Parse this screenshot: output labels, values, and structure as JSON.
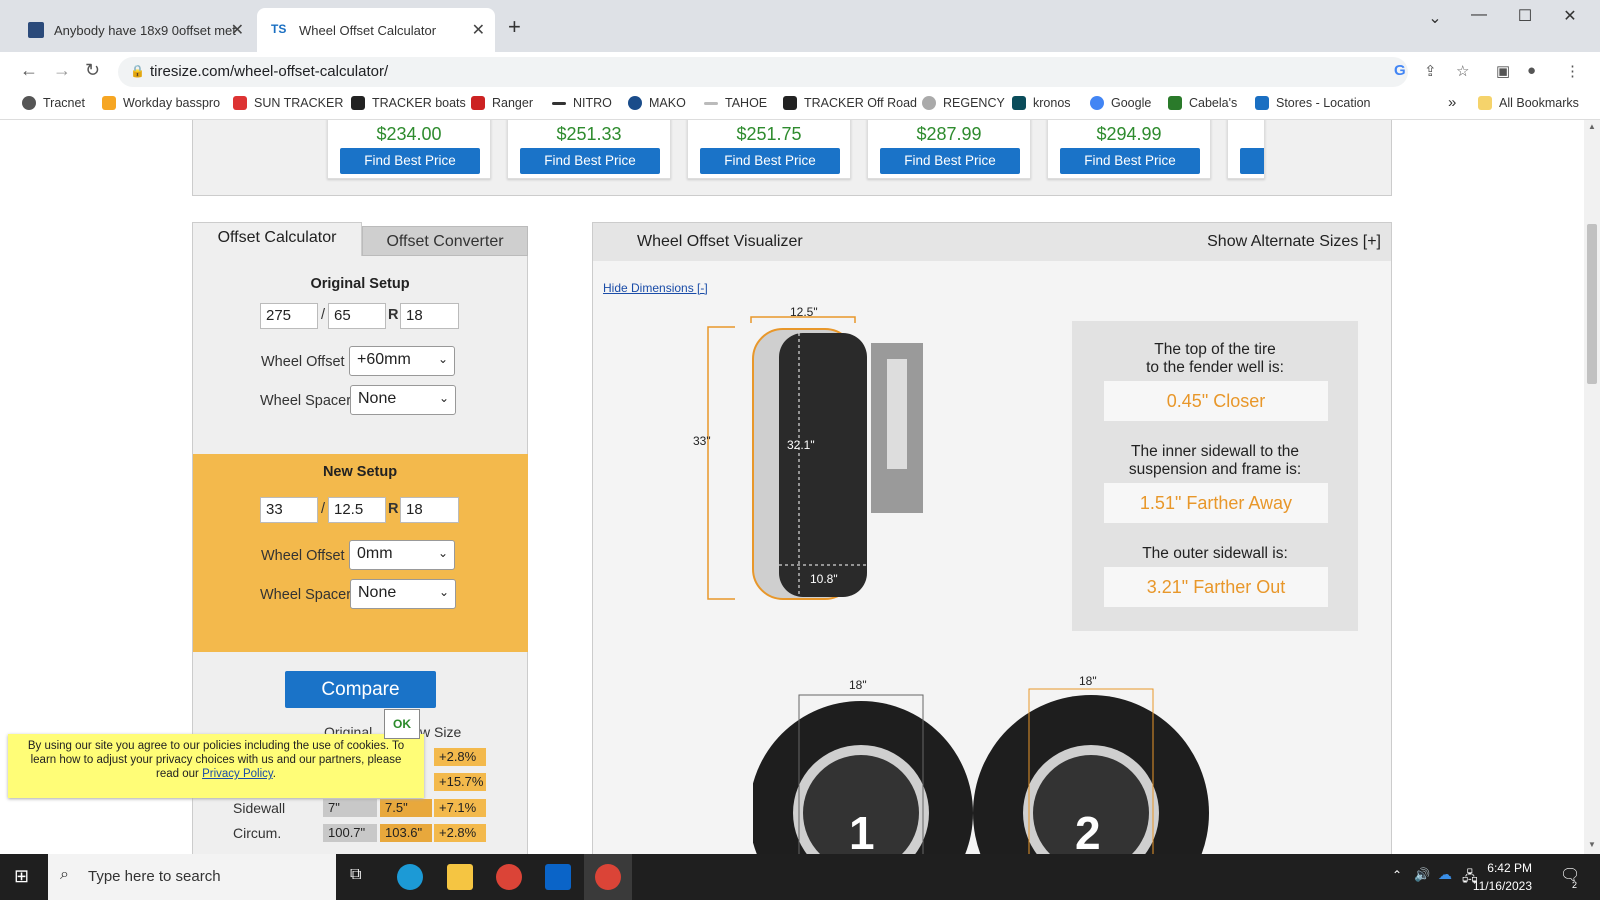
{
  "browser": {
    "tabs": [
      {
        "label": "Anybody have 18x9 0offset met"
      },
      {
        "label": "Wheel Offset Calculator"
      }
    ],
    "url": "tiresize.com/wheel-offset-calculator/",
    "bookmarks": [
      "Tracnet",
      "Workday basspro",
      "SUN TRACKER",
      "TRACKER boats",
      "Ranger",
      "NITRO",
      "MAKO",
      "TAHOE",
      "TRACKER Off Road",
      "REGENCY",
      "kronos",
      "Google",
      "Cabela's",
      "Stores - Location"
    ],
    "all_bookmarks": "All Bookmarks",
    "overflow": "»"
  },
  "products": [
    {
      "price": "$234.00",
      "button": "Find Best Price"
    },
    {
      "price": "$251.33",
      "button": "Find Best Price"
    },
    {
      "price": "$251.75",
      "button": "Find Best Price"
    },
    {
      "price": "$287.99",
      "button": "Find Best Price"
    },
    {
      "price": "$294.99",
      "button": "Find Best Price"
    }
  ],
  "calculator": {
    "tab_active": "Offset Calculator",
    "tab_other": "Offset Converter",
    "original": {
      "heading": "Original Setup",
      "width": "275",
      "sep": "/",
      "aspect": "65",
      "r": "R",
      "rim": "18",
      "offset_label": "Wheel Offset",
      "offset_value": "+60mm",
      "spacer_label": "Wheel Spacer",
      "spacer_value": "None"
    },
    "new": {
      "heading": "New Setup",
      "width": "33",
      "sep": "/",
      "aspect": "12.5",
      "r": "R",
      "rim": "18",
      "offset_label": "Wheel Offset",
      "offset_value": "0mm",
      "spacer_label": "Wheel Spacer",
      "spacer_value": "None"
    },
    "compare": "Compare",
    "table": {
      "col_original": "Original",
      "col_new": "w Size",
      "rows": [
        {
          "label": "",
          "orig": "",
          "new": "",
          "diff": "+2.8%"
        },
        {
          "label": "",
          "orig": "",
          "new": "",
          "diff": "+15.7%"
        },
        {
          "label": "Sidewall",
          "orig": "7\"",
          "new": "7.5\"",
          "diff": "+7.1%"
        },
        {
          "label": "Circum.",
          "orig": "100.7\"",
          "new": "103.6\"",
          "diff": "+2.8%"
        }
      ]
    }
  },
  "cookie": {
    "text": "By using our site you agree to our policies including the use of cookies. To learn how to adjust your privacy choices with us and our partners, please read our",
    "link": "Privacy Policy",
    "end": ".",
    "ok": "OK"
  },
  "visualizer": {
    "title": "Wheel Offset Visualizer",
    "alternate": "Show Alternate Sizes [+]",
    "hide_dims": "Hide Dimensions [-]",
    "dims": {
      "width_top": "12.5\"",
      "height": "33\"",
      "orig_height": "32.1\"",
      "orig_width": "10.8\"",
      "rim1": "18\"",
      "rim2": "18\"",
      "label1": "1",
      "label2": "2"
    },
    "results": [
      {
        "question": "The top of the tire to the fender well is:",
        "q1": "The top of the tire",
        "q2": "to the fender well is:",
        "value": "0.45\" Closer"
      },
      {
        "question": "The inner sidewall to the suspension and frame is:",
        "q1": "The inner sidewall to the",
        "q2": "suspension and frame is:",
        "value": "1.51\" Farther Away"
      },
      {
        "question": "The outer sidewall is:",
        "q1": "The outer sidewall is:",
        "q2": "",
        "value": "3.21\" Farther Out"
      }
    ],
    "accent": "#e8972a"
  },
  "taskbar": {
    "search_placeholder": "Type here to search",
    "time": "6:42 PM",
    "date": "11/16/2023",
    "notif_count": "2"
  }
}
